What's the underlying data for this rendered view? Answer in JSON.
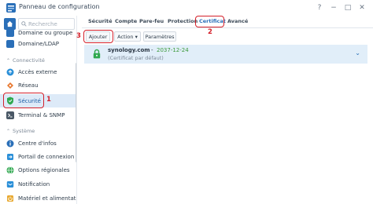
{
  "window": {
    "title": "Panneau de configuration",
    "controls": [
      "?",
      "−",
      "□",
      "✕"
    ]
  },
  "sidebar": {
    "search_placeholder": "Recherche",
    "items": [
      {
        "label": "Domaine ou groupe",
        "icon": "domain-icon",
        "color": "#2a6fb8"
      },
      {
        "label": "Domaine/LDAP",
        "icon": "ldap-icon",
        "color": "#2a6fb8"
      },
      {
        "label": "Accès externe",
        "icon": "external-access-icon",
        "color": "#2a8fd8"
      },
      {
        "label": "Réseau",
        "icon": "network-icon",
        "color": "#e8772e"
      },
      {
        "label": "Sécurité",
        "icon": "shield-icon",
        "color": "#2fa84f"
      },
      {
        "label": "Terminal & SNMP",
        "icon": "terminal-icon",
        "color": "#4a5866"
      },
      {
        "label": "Centre d'infos",
        "icon": "info-icon",
        "color": "#2a6fb8"
      },
      {
        "label": "Portail de connexion",
        "icon": "login-portal-icon",
        "color": "#2a8fd8"
      },
      {
        "label": "Options régionales",
        "icon": "regional-options-icon",
        "color": "#2fa84f"
      },
      {
        "label": "Notification",
        "icon": "notification-icon",
        "color": "#2a8fd8"
      },
      {
        "label": "Matériel et alimentation",
        "icon": "hardware-power-icon",
        "color": "#e8a82e"
      }
    ],
    "groups": [
      {
        "label": "Connectivité"
      },
      {
        "label": "Système"
      }
    ]
  },
  "tabs": [
    {
      "label": "Sécurité"
    },
    {
      "label": "Compte"
    },
    {
      "label": "Pare-feu"
    },
    {
      "label": "Protection"
    },
    {
      "label": "Certificat"
    },
    {
      "label": "Avancé"
    }
  ],
  "toolbar": {
    "add_label": "Ajouter",
    "action_label": "Action ▾",
    "settings_label": "Paramètres"
  },
  "certificate": {
    "domain": "synology.com",
    "separator": "-",
    "expiry": "2037-12-24",
    "description": "(Certificat par défaut)"
  },
  "annotations": {
    "one": "1",
    "two": "2",
    "three": "3"
  },
  "colors": {
    "accent": "#2a6fb8",
    "selection": "#e1eef9",
    "valid_date": "#3b9a3b",
    "annotation": "#d4202a"
  }
}
